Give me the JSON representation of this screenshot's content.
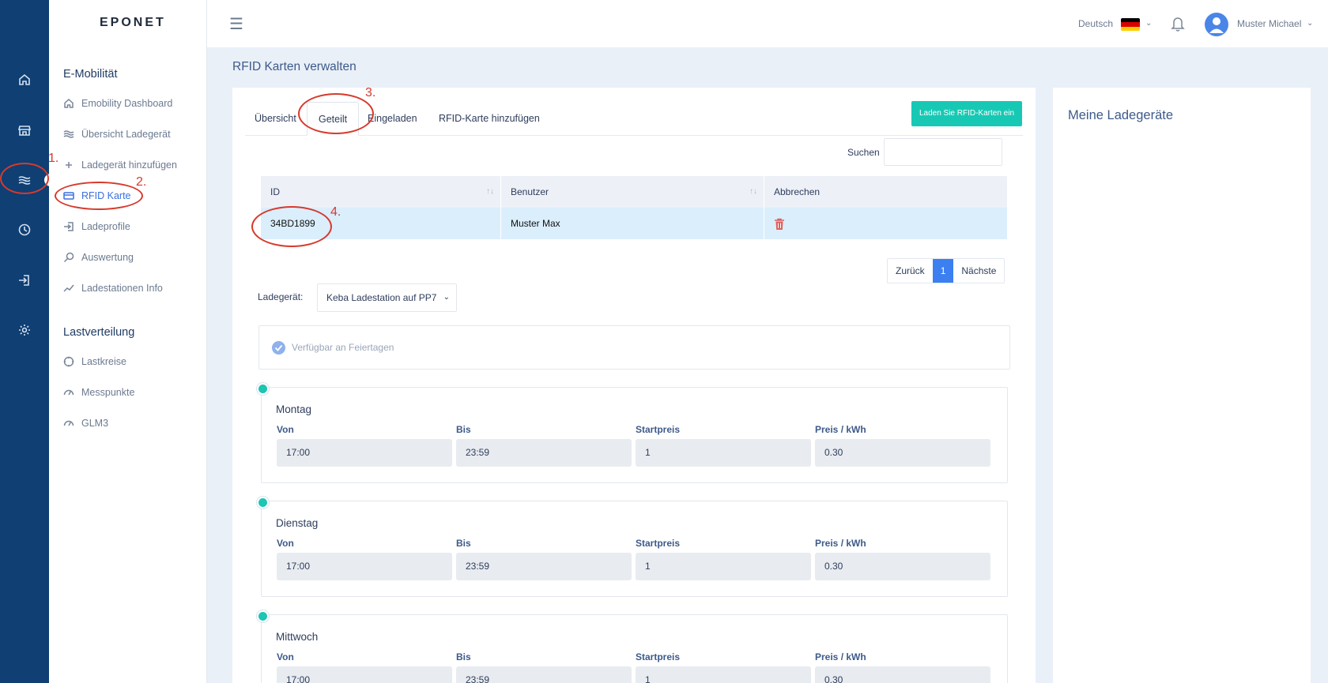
{
  "logo": "EPONET",
  "topbar": {
    "language": "Deutsch",
    "username": "Muster Michael"
  },
  "sidebar": {
    "section1": "E-Mobilität",
    "items1": [
      {
        "label": "Emobility Dashboard",
        "icon": "home-icon"
      },
      {
        "label": "Übersicht Ladegerät",
        "icon": "waves-icon"
      },
      {
        "label": "Ladegerät hinzufügen",
        "icon": "plus-icon"
      },
      {
        "label": "RFID Karte",
        "icon": "card-icon"
      },
      {
        "label": "Ladeprofile",
        "icon": "login-icon"
      },
      {
        "label": "Auswertung",
        "icon": "search-icon"
      },
      {
        "label": "Ladestationen Info",
        "icon": "trend-icon"
      }
    ],
    "section2": "Lastverteilung",
    "items2": [
      {
        "label": "Lastkreise",
        "icon": "circle-icon"
      },
      {
        "label": "Messpunkte",
        "icon": "gauge-icon"
      },
      {
        "label": "GLM3",
        "icon": "gauge-icon"
      }
    ]
  },
  "page": {
    "title": "RFID Karten verwalten",
    "right_title": "Meine Ladegeräte"
  },
  "tabs": [
    "Übersicht",
    "Geteilt",
    "Eingeladen",
    "RFID-Karte hinzufügen"
  ],
  "load_button": "Laden Sie RFID-Karten ein",
  "search_label": "Suchen",
  "table": {
    "headers": [
      "ID",
      "Benutzer",
      "Abbrechen"
    ],
    "rows": [
      {
        "id": "34BD1899",
        "user": "Muster Max"
      }
    ]
  },
  "pager": {
    "prev": "Zurück",
    "current": "1",
    "next": "Nächste"
  },
  "charger": {
    "label": "Ladegerät:",
    "value": "Keba Ladestation auf PP7"
  },
  "holiday_label": "Verfügbar an Feiertagen",
  "field_labels": {
    "from": "Von",
    "to": "Bis",
    "start": "Startpreis",
    "price": "Preis / kWh"
  },
  "days": [
    {
      "name": "Montag",
      "from": "17:00",
      "to": "23:59",
      "start": "1",
      "price": "0.30"
    },
    {
      "name": "Dienstag",
      "from": "17:00",
      "to": "23:59",
      "start": "1",
      "price": "0.30"
    },
    {
      "name": "Mittwoch",
      "from": "17:00",
      "to": "23:59",
      "start": "1",
      "price": "0.30"
    }
  ],
  "annotations": [
    "1.",
    "2.",
    "3.",
    "4."
  ],
  "colors": {
    "rail": "#0f3f73",
    "accent": "#17c9b4",
    "active": "#3b6fe0",
    "annotation": "#d63a2c"
  }
}
